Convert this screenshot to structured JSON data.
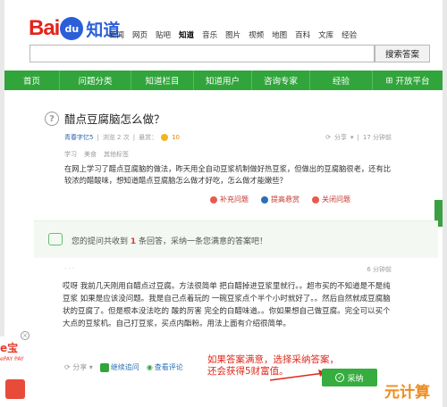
{
  "header": {
    "logo_bai": "Bai",
    "logo_du": "du",
    "logo_zhidao": "知道",
    "nav": [
      "新闻",
      "网页",
      "贴吧",
      "知道",
      "音乐",
      "图片",
      "视频",
      "地图",
      "百科",
      "文库",
      "经验"
    ],
    "active_nav": "知道",
    "search_value": "",
    "search_button": "搜索答案"
  },
  "greennav": [
    "首页",
    "问题分类",
    "知道栏目",
    "知道用户",
    "咨询专家",
    "经验",
    "开放平台"
  ],
  "question": {
    "title": "醋点豆腐脑怎么做？",
    "user": "青春字忆5",
    "views": "浏览 2 次",
    "reward_label": "悬赏：",
    "reward": "10",
    "share": "分享",
    "time": "17 分钟前",
    "tags": [
      "学习",
      "美食",
      "其他标签"
    ],
    "body": "在网上学习了醋点豆腐脑的做法，昨天用全自动豆浆机制做好热豆浆，但做出的豆腐脑很老，还有比较浓的醋酸味，想知道醋点豆腐脑怎么做才好吃，怎么做才能嫩些？",
    "actions": [
      "补充问题",
      "提高悬赏",
      "关闭问题"
    ]
  },
  "banner": {
    "text_prefix": "您的提问共收到",
    "count": "1",
    "text_suffix": "条回答，采纳一条您满意的答案吧！"
  },
  "answer": {
    "user": "·  ·  ·",
    "time": "6 分钟前",
    "body": "哎呀 我前几天刚用白醋点过豆腐。方法很简单 把白醋掉进豆浆里就行。。超市买的不知道是不是纯豆浆 如果是应该没问题。我是自己点着玩的 一碗豆浆点个半个小时就好了。。然后自然就成豆腐脑状的豆腐了。但是根本没法吃的 酸的厉害 完全的白醋味道。。你如果想自己做豆腐。完全可以买个大点的豆浆机。自己打豆浆，买点内酯粉。用法上面有介绍很简单。",
    "share": "分享",
    "continue_ask": "继续追问",
    "view_comment": "查看评论",
    "adopt": "采纳"
  },
  "annotation": {
    "line1": "如果答案满意，选择采纳答案，",
    "line2": "还会获得5财富值。"
  },
  "watermark": "元计算",
  "ad": {
    "t1": "e宝",
    "t2": "ePAY PAY"
  },
  "colors": {
    "green": "#31a53b",
    "red": "#e0271b",
    "blue": "#2b5fd9"
  }
}
